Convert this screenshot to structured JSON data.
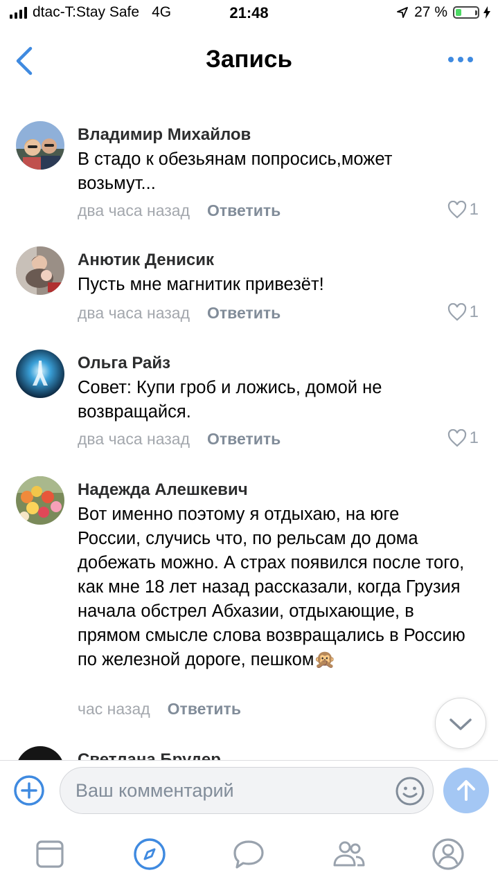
{
  "status_bar": {
    "carrier": "dtac-T:Stay Safe",
    "network": "4G",
    "time": "21:48",
    "battery_percent": "27 %",
    "battery_level": 0.27,
    "battery_color": "#4cd964"
  },
  "header": {
    "title": "Запись",
    "back_icon": "chevron-left-icon",
    "more_icon": "more-horizontal-icon",
    "accent": "#3f8ae0"
  },
  "comments": [
    {
      "author": "Владимир Михайлов",
      "text": "В стадо к обезьянам попросись,может возьмут...",
      "time": "два часа назад",
      "reply": "Ответить",
      "likes": "1"
    },
    {
      "author": "Анютик Денисик",
      "text": "Пусть мне магнитик привезёт!",
      "time": "два часа назад",
      "reply": "Ответить",
      "likes": "1"
    },
    {
      "author": "Ольга Райз",
      "text": "Совет: Купи гроб и ложись, домой не возвращайся.",
      "time": "два часа назад",
      "reply": "Ответить",
      "likes": "1"
    },
    {
      "author": "Надежда Алешкевич",
      "text": "Вот именно поэтому я отдыхаю, на  юге России, случись что, по рельсам до дома добежать можно. А страх появился после того, как мне 18 лет назад рассказали, когда Грузия начала обстрел Абхазии, отдыхающие, в прямом смысле слова возвращались в Россию по железной дороге, пешком🙊",
      "time": "час назад",
      "reply": "Ответить",
      "likes": ""
    },
    {
      "author": "Светлана Брудер"
    }
  ],
  "composer": {
    "placeholder": "Ваш комментарий",
    "add_icon": "plus-circle-icon",
    "emoji_icon": "smile-icon",
    "send_icon": "send-arrow-icon"
  },
  "tab_bar": {
    "tabs": [
      "news-icon",
      "discover-icon",
      "messages-icon",
      "friends-icon",
      "profile-icon"
    ],
    "active": "discover-icon"
  }
}
